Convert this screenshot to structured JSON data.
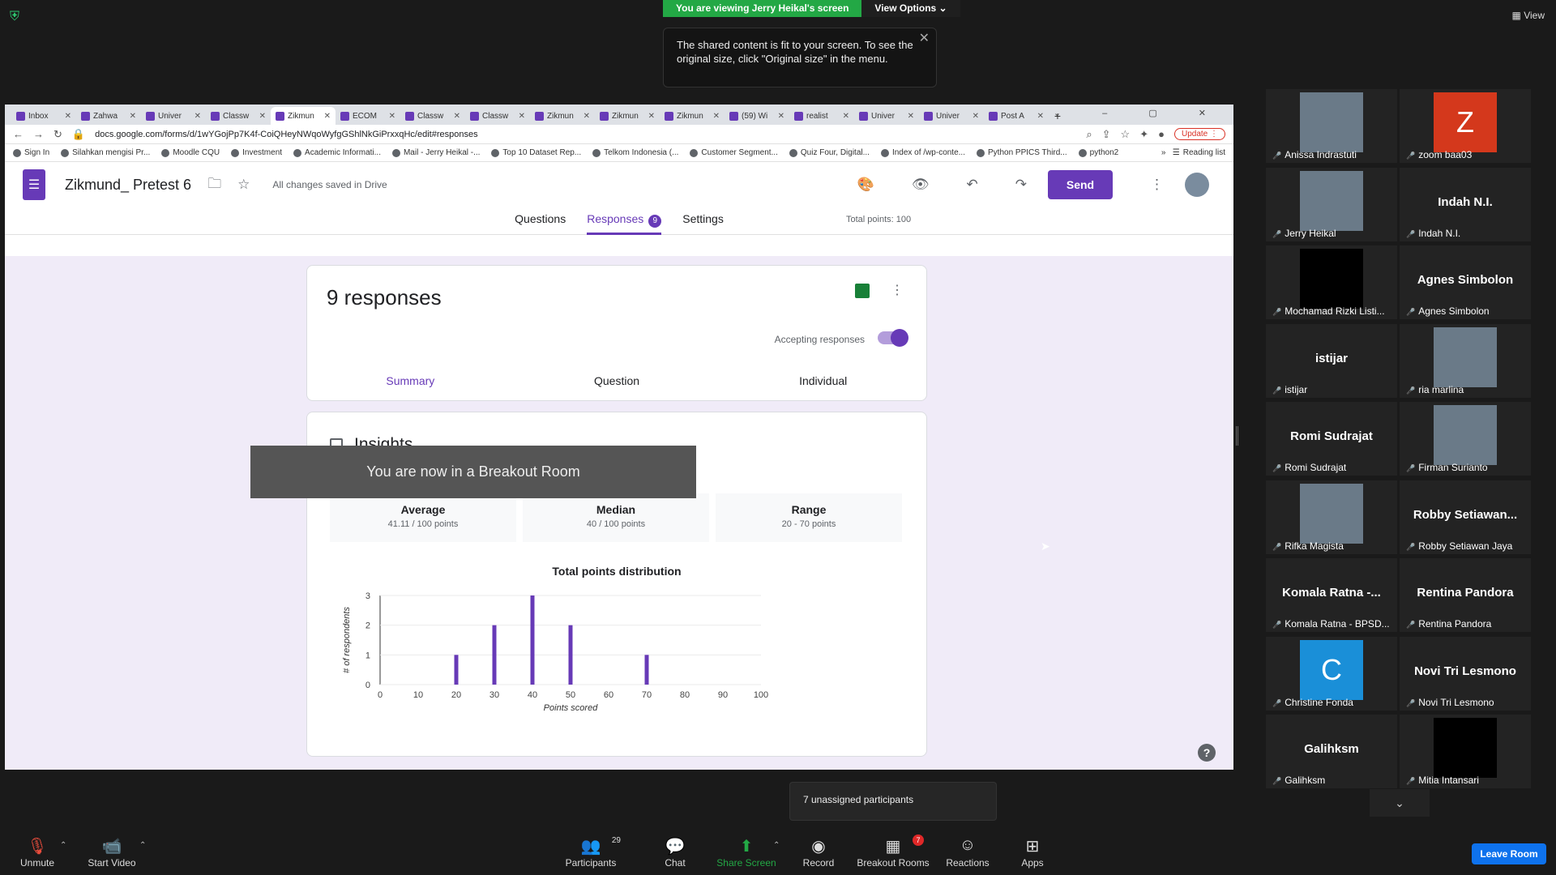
{
  "zoom": {
    "view_label": "View",
    "share_banner": "You are viewing Jerry Heikal's screen",
    "view_options": "View Options",
    "tooltip_text": "The shared content is fit to your screen. To see the original size, click \"Original size\" in the menu.",
    "breakout_toast": "You are now in a Breakout Room",
    "unassigned": "7 unassigned participants",
    "leave_room": "Leave Room"
  },
  "browser": {
    "tabs": [
      "Inbox",
      "Zahwa",
      "Univer",
      "Classw",
      "Zikmun",
      "ECOM",
      "Classw",
      "Classw",
      "Zikmun",
      "Zikmun",
      "Zikmun",
      "(59) Wi",
      "realist",
      "Univer",
      "Univer",
      "Post A"
    ],
    "active_tab_index": 4,
    "url": "docs.google.com/forms/d/1wYGojPp7K4f-CoiQHeyNWqoWyfgGShlNkGiPrxxqHc/edit#responses",
    "update_label": "Update",
    "bookmarks": [
      "Sign In",
      "Silahkan mengisi Pr...",
      "Moodle CQU",
      "Investment",
      "Academic Informati...",
      "Mail - Jerry Heikal -...",
      "Top 10 Dataset Rep...",
      "Telkom Indonesia (...",
      "Customer Segment...",
      "Quiz Four, Digital...",
      "Index of /wp-conte...",
      "Python PPICS Third...",
      "python2"
    ],
    "reading_list": "Reading list"
  },
  "form": {
    "title": "Zikmund_ Pretest 6",
    "saved_status": "All changes saved in Drive",
    "send_label": "Send",
    "tabs": {
      "questions": "Questions",
      "responses": "Responses",
      "responses_count": "9",
      "settings": "Settings"
    },
    "total_points": "Total points: 100",
    "responses_title": "9 responses",
    "accepting": "Accepting responses",
    "subtabs": {
      "summary": "Summary",
      "question": "Question",
      "individual": "Individual"
    },
    "insights_title": "Insights",
    "stats": {
      "average_label": "Average",
      "average_value": "41.11 / 100 points",
      "median_label": "Median",
      "median_value": "40 / 100 points",
      "range_label": "Range",
      "range_value": "20 - 70 points"
    }
  },
  "chart_data": {
    "type": "bar",
    "title": "Total points distribution",
    "xlabel": "Points scored",
    "ylabel": "# of respondents",
    "x": [
      20,
      30,
      40,
      50,
      70
    ],
    "values": [
      1,
      2,
      3,
      2,
      1
    ],
    "xlim": [
      0,
      100
    ],
    "ylim": [
      0,
      3
    ],
    "xticks": [
      0,
      10,
      20,
      30,
      40,
      50,
      60,
      70,
      80,
      90,
      100
    ],
    "yticks": [
      0,
      1,
      2,
      3
    ],
    "bar_color": "#673ab7"
  },
  "participants": [
    {
      "name": "Anissa Indrastuti",
      "kind": "photo"
    },
    {
      "name": "zoom baa03",
      "kind": "letter",
      "letter": "Z",
      "color": "#d4381c"
    },
    {
      "name": "Jerry Heikal",
      "kind": "photo"
    },
    {
      "name": "Indah N.I.",
      "kind": "text",
      "display": "Indah N.I."
    },
    {
      "name": "Mochamad Rizki Listi...",
      "kind": "black"
    },
    {
      "name": "Agnes Simbolon",
      "kind": "text",
      "display": "Agnes Simbolon"
    },
    {
      "name": "istijar",
      "kind": "text",
      "display": "istijar"
    },
    {
      "name": "ria marlina",
      "kind": "photo"
    },
    {
      "name": "Romi Sudrajat",
      "kind": "text",
      "display": "Romi Sudrajat"
    },
    {
      "name": "Firman Surianto",
      "kind": "photo"
    },
    {
      "name": "Rifka Magista",
      "kind": "photo"
    },
    {
      "name": "Robby Setiawan Jaya",
      "kind": "text",
      "display": "Robby  Setiawan..."
    },
    {
      "name": "Komala Ratna - BPSD...",
      "kind": "text",
      "display": "Komala Ratna -..."
    },
    {
      "name": "Rentina Pandora",
      "kind": "text",
      "display": "Rentina Pandora"
    },
    {
      "name": "Christine Fonda",
      "kind": "letter",
      "letter": "C",
      "color": "#1a8fd8"
    },
    {
      "name": "Novi Tri Lesmono",
      "kind": "text",
      "display": "Novi Tri Lesmono"
    },
    {
      "name": "Galihksm",
      "kind": "text",
      "display": "Galihksm"
    },
    {
      "name": "Mitia Intansari",
      "kind": "black"
    }
  ],
  "toolbar": {
    "unmute": "Unmute",
    "start_video": "Start Video",
    "participants": "Participants",
    "participants_count": "29",
    "chat": "Chat",
    "share_screen": "Share Screen",
    "record": "Record",
    "breakout_rooms": "Breakout Rooms",
    "breakout_badge": "7",
    "reactions": "Reactions",
    "apps": "Apps"
  }
}
